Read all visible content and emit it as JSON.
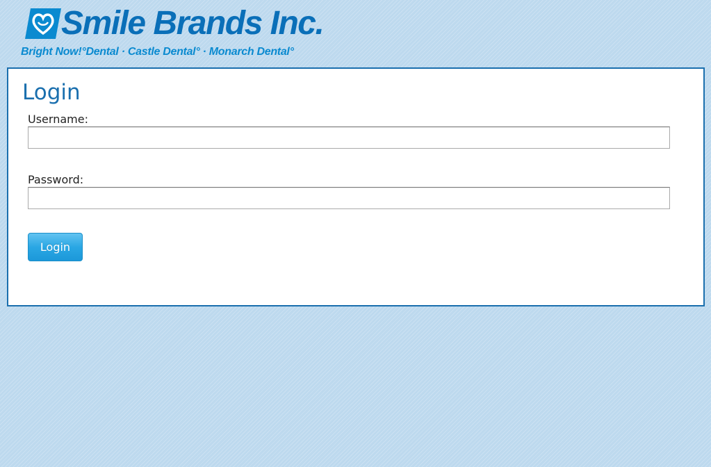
{
  "header": {
    "brand_name": "Smile Brands Inc.",
    "tagline": "Bright Now!°Dental · Castle Dental° · Monarch Dental°",
    "logo_icon": "smile-heart-icon",
    "brand_color": "#0a6fb8"
  },
  "login": {
    "title": "Login",
    "username_label": "Username:",
    "username_value": "",
    "password_label": "Password:",
    "password_value": "",
    "submit_label": "Login"
  },
  "colors": {
    "background": "#bdd9ee",
    "panel_border": "#1a6fae",
    "title": "#1a6fae",
    "button": "#2aa7e4"
  }
}
